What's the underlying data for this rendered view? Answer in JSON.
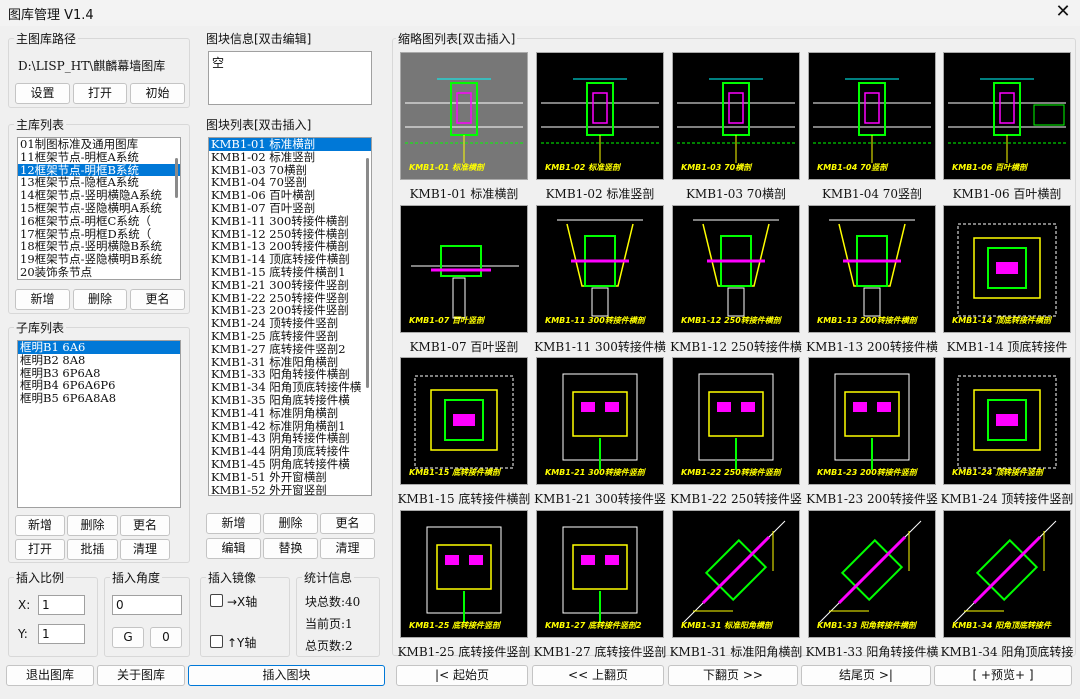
{
  "window": {
    "title": "图库管理 V1.4",
    "close_glyph": "✕"
  },
  "main_path": {
    "label": "主图库路径",
    "value": "D:\\LISP_HT\\麒麟幕墙图库",
    "buttons": [
      "设置",
      "打开",
      "初始"
    ]
  },
  "main_list": {
    "label": "主库列表",
    "items": [
      "01制图标准及通用图库",
      "11框架节点-明框A系统",
      "12框架节点-明框B系统",
      "13框架节点-隐框A系统",
      "14框架节点-竖明横隐A系统",
      "15框架节点-竖隐横明A系统",
      "16框架节点-明框C系统（",
      "17框架节点-明框D系统（",
      "18框架节点-竖明横隐B系统",
      "19框架节点-竖隐横明B系统",
      "20装饰条节点"
    ],
    "selected": 2,
    "buttons": [
      "新增",
      "删除",
      "更名"
    ]
  },
  "sub_list": {
    "label": "子库列表",
    "items": [
      "框明B1 6A6",
      "框明B2 8A8",
      "框明B3 6P6A8",
      "框明B4 6P6A6P6",
      "框明B5 6P6A8A8"
    ],
    "selected": 0,
    "buttons_row1": [
      "新增",
      "删除",
      "更名"
    ],
    "buttons_row2": [
      "打开",
      "批插",
      "清理"
    ]
  },
  "block_info": {
    "label": "图块信息[双击编辑]",
    "value": "空"
  },
  "block_list": {
    "label": "图块列表[双击插入]",
    "items": [
      "KMB1-01 标准横剖",
      "KMB1-02 标准竖剖",
      "KMB1-03 70横剖",
      "KMB1-04 70竖剖",
      "KMB1-06 百叶横剖",
      "KMB1-07 百叶竖剖",
      "KMB1-11 300转接件横剖",
      "KMB1-12 250转接件横剖",
      "KMB1-13 200转接件横剖",
      "KMB1-14 顶底转接件横剖",
      "KMB1-15 底转接件横剖1",
      "KMB1-21 300转接件竖剖",
      "KMB1-22 250转接件竖剖",
      "KMB1-23 200转接件竖剖",
      "KMB1-24 顶转接件竖剖",
      "KMB1-25 底转接件竖剖",
      "KMB1-27 底转接件竖剖2",
      "KMB1-31 标准阳角横剖",
      "KMB1-33 阳角转接件横剖",
      "KMB1-34 阳角顶底转接件横",
      "KMB1-35 阳角底转接件横",
      "KMB1-41 标准阴角横剖",
      "KMB1-42 标准阴角横剖1",
      "KMB1-43 阴角转接件横剖",
      "KMB1-44 阴角顶底转接件",
      "KMB1-45 阴角底转接件横",
      "KMB1-51 外开窗横剖",
      "KMB1-52 外开窗竖剖"
    ],
    "selected": 0,
    "buttons_row1": [
      "新增",
      "删除",
      "更名"
    ],
    "buttons_row2": [
      "编辑",
      "替换",
      "清理"
    ]
  },
  "scale": {
    "label": "插入比例",
    "x_label": "X:",
    "x_value": "1",
    "y_label": "Y:",
    "y_value": "1"
  },
  "angle": {
    "label": "插入角度",
    "value": "0",
    "g_button": "G",
    "zero_button": "0"
  },
  "mirror": {
    "label": "插入镜像",
    "x_axis": "→X轴",
    "y_axis": "↑Y轴"
  },
  "stats": {
    "label": "统计信息",
    "total_blocks": "块总数:40",
    "current_page": "当前页:1",
    "total_pages": "总页数:2"
  },
  "bottom_buttons": {
    "exit": "退出图库",
    "about": "关于图库",
    "insert": "插入图块"
  },
  "thumbnails": {
    "label": "缩略图列表[双击插入]",
    "items": [
      {
        "caption": "KMB1-01 标准横剖",
        "tag": "KMB1-01 标准横剖",
        "kind": "horiz",
        "selected": true
      },
      {
        "caption": "KMB1-02 标准竖剖",
        "tag": "KMB1-02 标准竖剖",
        "kind": "horiz"
      },
      {
        "caption": "KMB1-03 70横剖",
        "tag": "KMB1-03 70横剖",
        "kind": "horiz"
      },
      {
        "caption": "KMB1-04 70竖剖",
        "tag": "KMB1-04 70竖剖",
        "kind": "horiz"
      },
      {
        "caption": "KMB1-06 百叶横剖",
        "tag": "KMB1-06 百叶横剖",
        "kind": "louver"
      },
      {
        "caption": "KMB1-07 百叶竖剖",
        "tag": "KMB1-07 百叶竖剖",
        "kind": "vert"
      },
      {
        "caption": "KMB1-11 300转接件横",
        "tag": "KMB1-11 300转接件横剖",
        "kind": "bracket"
      },
      {
        "caption": "KMB1-12 250转接件横",
        "tag": "KMB1-12 250转接件横剖",
        "kind": "bracket"
      },
      {
        "caption": "KMB1-13 200转接件横",
        "tag": "KMB1-13 200转接件横剖",
        "kind": "bracket"
      },
      {
        "caption": "KMB1-14 顶底转接件",
        "tag": "KMB1-14 顶底转接件横剖",
        "kind": "box"
      },
      {
        "caption": "KMB1-15 底转接件横剖",
        "tag": "KMB1-15 底转接件横剖",
        "kind": "box"
      },
      {
        "caption": "KMB1-21 300转接件竖",
        "tag": "KMB1-21 300转接件竖剖",
        "kind": "plate"
      },
      {
        "caption": "KMB1-22 250转接件竖",
        "tag": "KMB1-22 250转接件竖剖",
        "kind": "plate"
      },
      {
        "caption": "KMB1-23 200转接件竖",
        "tag": "KMB1-23 200转接件竖剖",
        "kind": "plate"
      },
      {
        "caption": "KMB1-24 顶转接件竖剖",
        "tag": "KMB1-24 顶转接件竖剖",
        "kind": "box"
      },
      {
        "caption": "KMB1-25 底转接件竖剖",
        "tag": "KMB1-25 底转接件竖剖",
        "kind": "plate"
      },
      {
        "caption": "KMB1-27 底转接件竖剖",
        "tag": "KMB1-27 底转接件竖剖2",
        "kind": "plate"
      },
      {
        "caption": "KMB1-31 标准阳角横剖",
        "tag": "KMB1-31 标准阳角横剖",
        "kind": "diag"
      },
      {
        "caption": "KMB1-33 阳角转接件横",
        "tag": "KMB1-33 阳角转接件横剖",
        "kind": "diag"
      },
      {
        "caption": "KMB1-34 阳角顶底转接",
        "tag": "KMB1-34 阳角顶底转接件",
        "kind": "diag"
      }
    ]
  },
  "pager": {
    "first": "|< 起始页",
    "prev": "<< 上翻页",
    "next": "下翻页 >>",
    "last": "结尾页 >|",
    "preview": "[ +预览+ ]"
  }
}
